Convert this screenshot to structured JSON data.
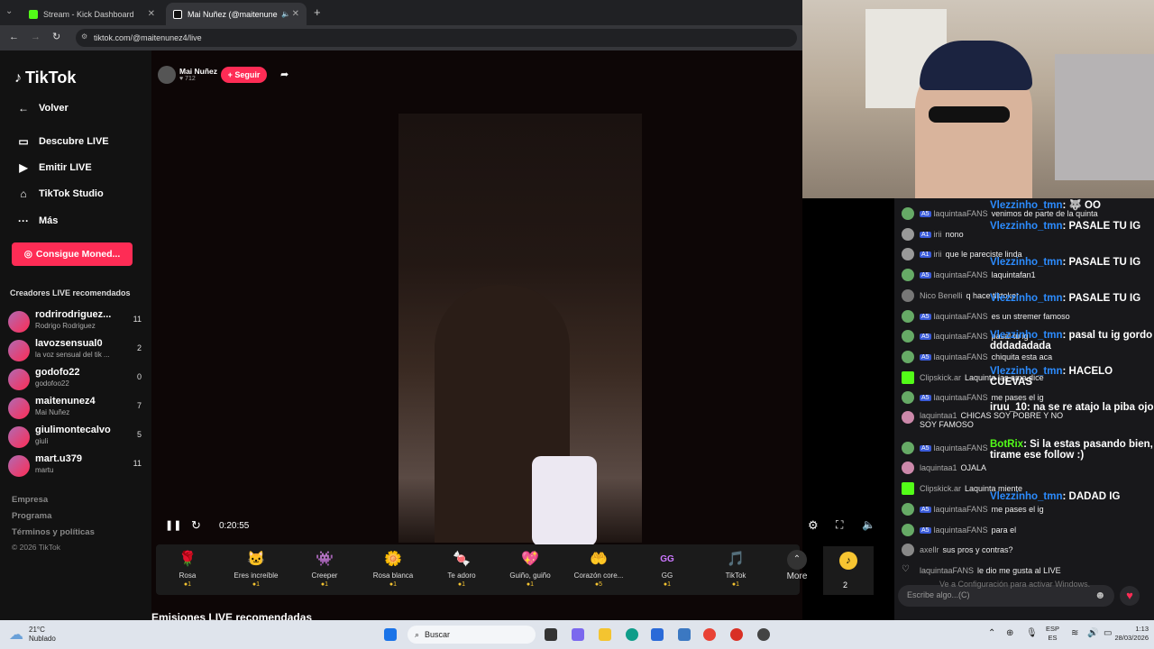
{
  "browser": {
    "tabs": [
      {
        "title": "Stream - Kick Dashboard"
      },
      {
        "title": "Mai Nuñez (@maitenunez4"
      }
    ],
    "url": "tiktok.com/@maitenunez4/live"
  },
  "sidebar": {
    "logo": "TikTok",
    "back": "Volver",
    "nav": [
      "Descubre LIVE",
      "Emitir LIVE",
      "TikTok Studio",
      "Más"
    ],
    "coins_button": "Consigue Moned...",
    "rec_title": "Creadores LIVE recomendados",
    "creators": [
      {
        "name": "rodrirodriguez...",
        "sub": "Rodrigo Rodriguez",
        "count": "11"
      },
      {
        "name": "lavozsensual0",
        "sub": "la voz sensual del tik ...",
        "count": "2"
      },
      {
        "name": "godofo22",
        "sub": "godofoo22",
        "count": "0"
      },
      {
        "name": "maitenunez4",
        "sub": "Mai Nuñez",
        "count": "7"
      },
      {
        "name": "giulimontecalvo",
        "sub": "giuli",
        "count": "5"
      },
      {
        "name": "mart.u379",
        "sub": "martu",
        "count": "11"
      }
    ],
    "footer": [
      "Empresa",
      "Programa",
      "Términos y políticas",
      "© 2026 TikTok"
    ]
  },
  "player": {
    "host": "Mai Nuñez",
    "likes": "712",
    "follow": "+ Seguir",
    "time": "0:20:55",
    "more": "More",
    "coin_count": "2",
    "gifts": [
      {
        "name": "Rosa",
        "price": "1",
        "icon": "🌹"
      },
      {
        "name": "Eres increíble",
        "price": "1",
        "icon": "🐱"
      },
      {
        "name": "Creeper",
        "price": "1",
        "icon": "👾"
      },
      {
        "name": "Rosa blanca",
        "price": "1",
        "icon": "🌼"
      },
      {
        "name": "Te adoro",
        "price": "1",
        "icon": "🍬"
      },
      {
        "name": "Guiño, guiño",
        "price": "1",
        "icon": "💖"
      },
      {
        "name": "Corazón core...",
        "price": "5",
        "icon": "🤲"
      },
      {
        "name": "GG",
        "price": "1",
        "icon": "GG"
      },
      {
        "name": "TikTok",
        "price": "1",
        "icon": "🎵"
      }
    ],
    "below": "Emisiones LIVE recomendadas"
  },
  "chat": {
    "messages": [
      {
        "user": "laquintaaFANS",
        "lvl": "5",
        "text": "venimos de parte de la quinta"
      },
      {
        "user": "irii",
        "lvl": "1",
        "text": "nono"
      },
      {
        "user": "irii",
        "lvl": "1",
        "text": "que le pareciste linda"
      },
      {
        "user": "laquintaaFANS",
        "lvl": "5",
        "text": "laquintafan1"
      },
      {
        "user": "Nico Benelli",
        "lvl": "",
        "text": "q hace tiktoker"
      },
      {
        "user": "laquintaaFANS",
        "lvl": "5",
        "text": "es un stremer famoso"
      },
      {
        "user": "laquintaaFANS",
        "lvl": "5",
        "text": "pasal tu ig"
      },
      {
        "user": "laquintaaFANS",
        "lvl": "5",
        "text": "chiquita esta aca"
      },
      {
        "user": "Clipskick.ar",
        "lvl": "",
        "text": "Laquinta las ama dice"
      },
      {
        "user": "laquintaaFANS",
        "lvl": "5",
        "text": "me pases el ig"
      },
      {
        "user": "laquintaa1",
        "lvl": "",
        "text": "CHICAS SOY POBRE Y NO SOY FAMOSO"
      },
      {
        "user": "laquintaaFANS",
        "lvl": "5",
        "text": ""
      },
      {
        "user": "laquintaa1",
        "lvl": "",
        "text": "OJALA"
      },
      {
        "user": "Clipskick.ar",
        "lvl": "",
        "text": "Laquinta miente"
      },
      {
        "user": "laquintaaFANS",
        "lvl": "5",
        "text": "me pases el ig"
      },
      {
        "user": "laquintaaFANS",
        "lvl": "5",
        "text": "para el"
      },
      {
        "user": "axellr",
        "lvl": "",
        "text": "sus pros y contras?"
      },
      {
        "user": "laquintaaFANS",
        "lvl": "",
        "text": "le dio me gusta al LIVE"
      }
    ],
    "overlay": [
      {
        "user": "Vlezzinho_tmn",
        "text": ": 🐺 OO"
      },
      {
        "user": "Vlezzinho_tmn",
        "text": ": PASALE TU IG"
      },
      {
        "user": "Vlezzinho_tmn",
        "text": ": PASALE TU IG"
      },
      {
        "user": "Vlezzinho_tmn",
        "text": ": PASALE TU IG"
      },
      {
        "user": "Vlezzinho_tmn",
        "text": ": pasal tu ig gordo dddadadada"
      },
      {
        "user": "Vlezzinho_tmn",
        "text": ": HACELO CUEVAS"
      },
      {
        "user": "iruu_10",
        "text": ": na se re atajo la piba ojo"
      },
      {
        "user": "BotRix",
        "text": ": Si la estas pasando bien, tirame ese follow :)"
      },
      {
        "user": "Vlezzinho_tmn",
        "text": ": DADAD IG"
      }
    ],
    "input_placeholder": "Escribe algo...(C)",
    "watermark": "Ve a Configuración para activar Windows."
  },
  "taskbar": {
    "weather_temp": "21°C",
    "weather_desc": "Nublado",
    "search": "Buscar",
    "lang1": "ESP",
    "lang2": "ES",
    "time": "1:13",
    "date": "28/03/2026"
  }
}
